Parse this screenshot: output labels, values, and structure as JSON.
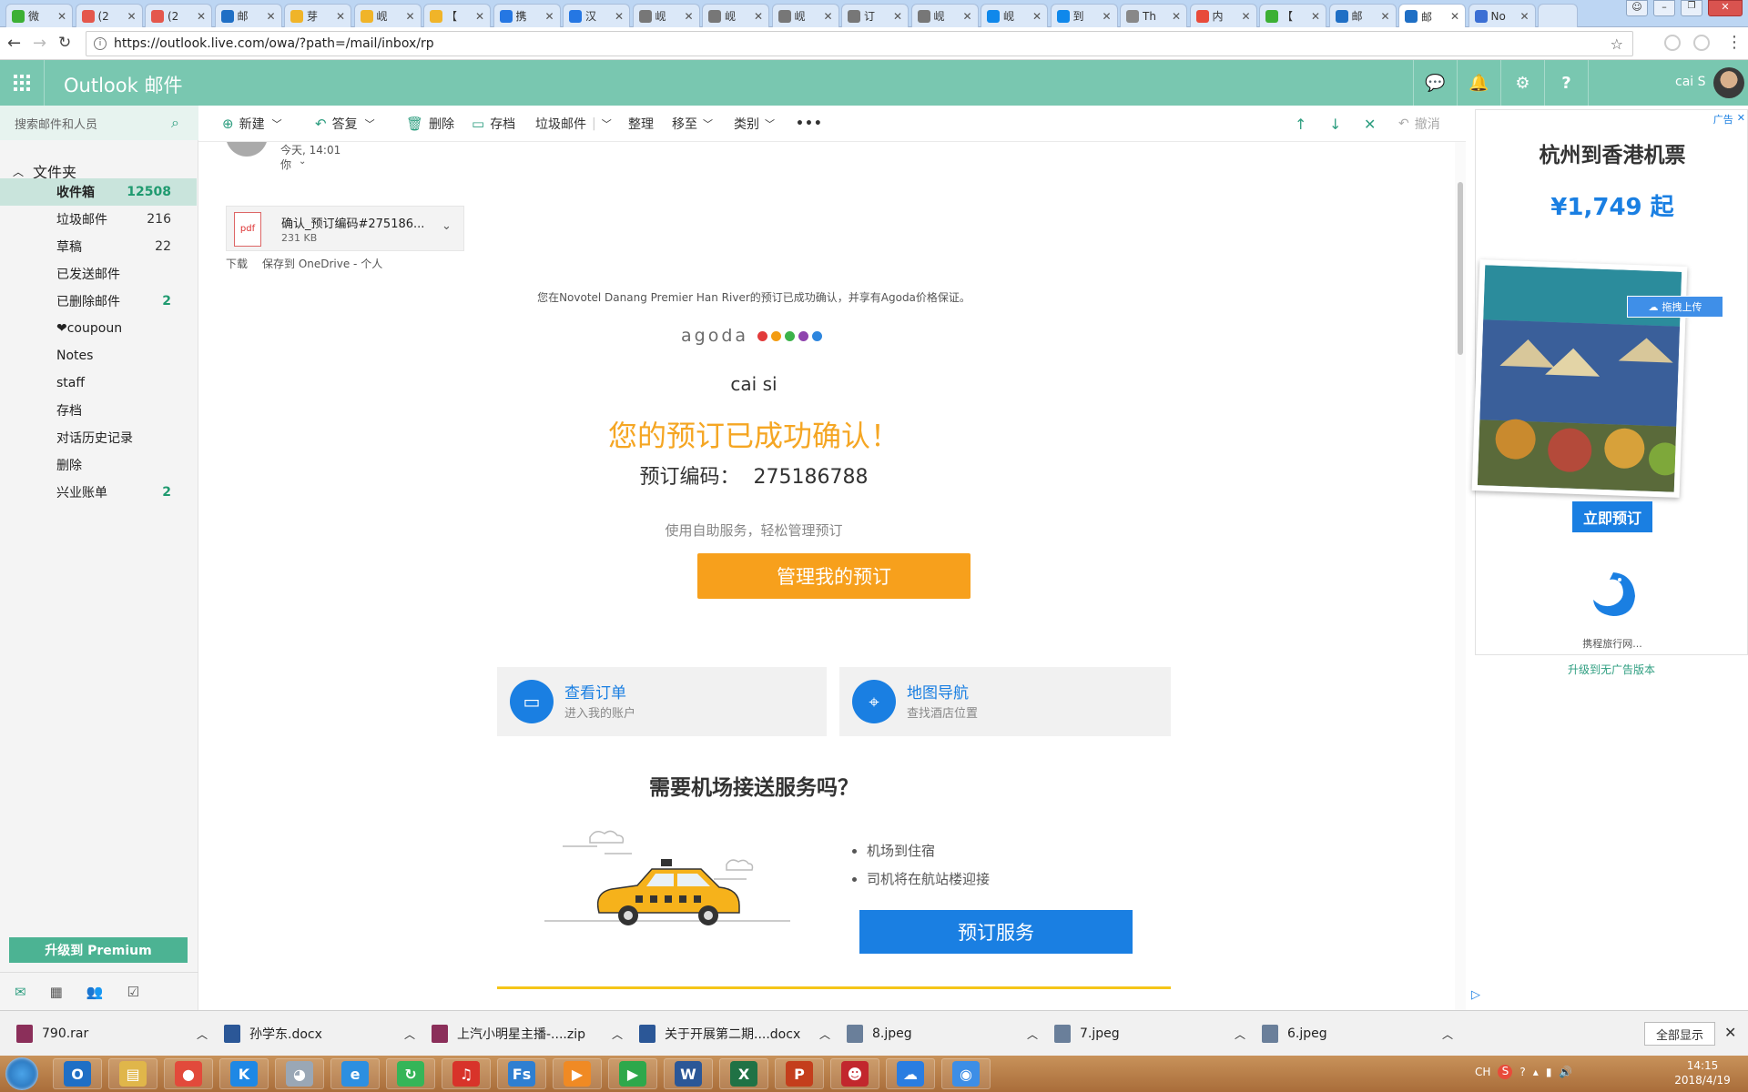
{
  "browser": {
    "tabs": [
      {
        "label": "微",
        "icon": "wechat-icon",
        "color": "#3cb034"
      },
      {
        "label": "(2",
        "icon": "xmind-icon",
        "color": "#e4574c"
      },
      {
        "label": "(2",
        "icon": "xmind-icon",
        "color": "#e4574c"
      },
      {
        "label": "邮",
        "icon": "outlook-icon",
        "color": "#1f6fc5"
      },
      {
        "label": "芽",
        "icon": "mail-icon",
        "color": "#f0b429"
      },
      {
        "label": "岘",
        "icon": "mail-icon",
        "color": "#f0b429"
      },
      {
        "label": "【",
        "icon": "mail-icon",
        "color": "#f0b429"
      },
      {
        "label": "携",
        "icon": "ctrip-icon",
        "color": "#2577e3"
      },
      {
        "label": "汉",
        "icon": "ctrip-icon",
        "color": "#2577e3"
      },
      {
        "label": "岘",
        "icon": "amazon-icon",
        "color": "#777777"
      },
      {
        "label": "岘",
        "icon": "amazon-icon",
        "color": "#777777"
      },
      {
        "label": "岘",
        "icon": "amazon-icon",
        "color": "#777777"
      },
      {
        "label": "订",
        "icon": "amazon-icon",
        "color": "#777777"
      },
      {
        "label": "岘",
        "icon": "amazon-icon",
        "color": "#777777"
      },
      {
        "label": "岘",
        "icon": "zhihu-icon",
        "color": "#0f88eb"
      },
      {
        "label": "到",
        "icon": "zhihu-icon",
        "color": "#0f88eb"
      },
      {
        "label": "Th",
        "icon": "document-icon",
        "color": "#888888"
      },
      {
        "label": "内",
        "icon": "sogou-icon",
        "color": "#e84b3a"
      },
      {
        "label": "【",
        "icon": "wechat-icon",
        "color": "#3cb034"
      },
      {
        "label": "邮",
        "icon": "outlook-icon",
        "color": "#1f6fc5"
      },
      {
        "label": "邮",
        "icon": "outlook-icon",
        "color": "#1f6fc5"
      },
      {
        "label": "No",
        "icon": "loading-icon",
        "color": "#3b6fd4"
      }
    ],
    "url": "https://outlook.live.com/owa/?path=/mail/inbox/rp"
  },
  "header": {
    "brand": "Outlook 邮件",
    "user": "cai S"
  },
  "sidebar": {
    "search_placeholder": "搜索邮件和人员",
    "folders_label": "文件夹",
    "folders": [
      {
        "label": "收件箱",
        "count": "12508"
      },
      {
        "label": "垃圾邮件",
        "count": "216"
      },
      {
        "label": "草稿",
        "count": "22"
      },
      {
        "label": "已发送邮件",
        "count": ""
      },
      {
        "label": "已删除邮件",
        "count": "2"
      },
      {
        "label": "❤coupoun",
        "count": ""
      },
      {
        "label": "Notes",
        "count": ""
      },
      {
        "label": "staff",
        "count": ""
      },
      {
        "label": "存档",
        "count": ""
      },
      {
        "label": "对话历史记录",
        "count": ""
      },
      {
        "label": "删除",
        "count": ""
      },
      {
        "label": "兴业账单",
        "count": "2"
      }
    ],
    "premium_button": "升级到 Premium"
  },
  "toolbar": {
    "new": "新建",
    "reply": "答复",
    "delete": "删除",
    "archive": "存档",
    "junk": "垃圾邮件",
    "sweep": "整理",
    "move": "移至",
    "categories": "类别",
    "more": "•••",
    "undo": "撤消"
  },
  "email": {
    "time": "今天, 14:01",
    "to": "你",
    "attachment": {
      "name": "确认_预订编码#275186...",
      "size": "231 KB",
      "type_label": "pdf"
    },
    "download": "下载",
    "save_onedrive": "保存到 OneDrive - 个人",
    "intro": "您在Novotel Danang Premier Han River的预订已成功确认，并享有Agoda价格保证。",
    "logo": "agoda",
    "guest": "cai si",
    "headline": "您的预订已成功确认！",
    "booking_label": "预订编码：",
    "booking_number": "275186788",
    "self_service": "使用自助服务，轻松管理预订",
    "manage_button": "管理我的预订",
    "cards": [
      {
        "title": "查看订单",
        "subtitle": "进入我的账户",
        "icon": "inbox-tray-icon"
      },
      {
        "title": "地图导航",
        "subtitle": "查找酒店位置",
        "icon": "map-pin-icon"
      }
    ],
    "airport_heading": "需要机场接送服务吗？",
    "airport_points": [
      "机场到住宿",
      "司机将在航站楼迎接"
    ],
    "airport_button": "预订服务"
  },
  "ad": {
    "label": "广告",
    "title": "杭州到香港机票",
    "price": "¥1,749 起",
    "upload_badge": "拖拽上传",
    "cta": "立即预订",
    "brand": "携程旅行网...",
    "upgrade": "升级到无广告版本"
  },
  "downloads": {
    "files": [
      {
        "name": "790.rar",
        "color": "#8b2f5a"
      },
      {
        "name": "孙学东.docx",
        "color": "#2b5797"
      },
      {
        "name": "上汽小明星主播-....zip",
        "color": "#8b2f5a"
      },
      {
        "name": "关于开展第二期....docx",
        "color": "#2b5797"
      },
      {
        "name": "8.jpeg",
        "color": "#6a7f9a"
      },
      {
        "name": "7.jpeg",
        "color": "#6a7f9a"
      },
      {
        "name": "6.jpeg",
        "color": "#6a7f9a"
      }
    ],
    "show_all": "全部显示"
  },
  "taskbar": {
    "items": [
      {
        "icon": "outlook-app-icon",
        "color": "#1f6fc5",
        "glyph": "O"
      },
      {
        "icon": "file-explorer-icon",
        "color": "#e0b64a",
        "glyph": "▤"
      },
      {
        "icon": "chrome-icon",
        "color": "#e24a3b",
        "glyph": "●"
      },
      {
        "icon": "kugou-icon",
        "color": "#1e88e5",
        "glyph": "K"
      },
      {
        "icon": "cat-app-icon",
        "color": "#9aa7b5",
        "glyph": "◕"
      },
      {
        "icon": "internet-explorer-icon",
        "color": "#2c8fe0",
        "glyph": "e"
      },
      {
        "icon": "sync-app-icon",
        "color": "#35b558",
        "glyph": "↻"
      },
      {
        "icon": "netease-music-icon",
        "color": "#d8332a",
        "glyph": "♫"
      },
      {
        "icon": "fs-app-icon",
        "color": "#2f7fd1",
        "glyph": "Fs"
      },
      {
        "icon": "video-player-icon",
        "color": "#f08a24",
        "glyph": "▶"
      },
      {
        "icon": "media-player-icon",
        "color": "#2ea84b",
        "glyph": "▶"
      },
      {
        "icon": "word-icon",
        "color": "#2b5797",
        "glyph": "W"
      },
      {
        "icon": "excel-icon",
        "color": "#207245",
        "glyph": "X"
      },
      {
        "icon": "powerpoint-icon",
        "color": "#c43e1c",
        "glyph": "P"
      },
      {
        "icon": "mask-app-icon",
        "color": "#c2272d",
        "glyph": "☻"
      },
      {
        "icon": "cloud-sync-icon",
        "color": "#2a7de1",
        "glyph": "☁"
      },
      {
        "icon": "qq-browser-icon",
        "color": "#3d8ee6",
        "glyph": "◉"
      }
    ],
    "lang": "CH",
    "time": "14:15",
    "date": "2018/4/19"
  },
  "colors": {
    "outlook_teal": "#79c7b0",
    "agoda_orange": "#f7a01c",
    "headline_orange": "#f5a623",
    "service_blue": "#1a7fe2"
  }
}
